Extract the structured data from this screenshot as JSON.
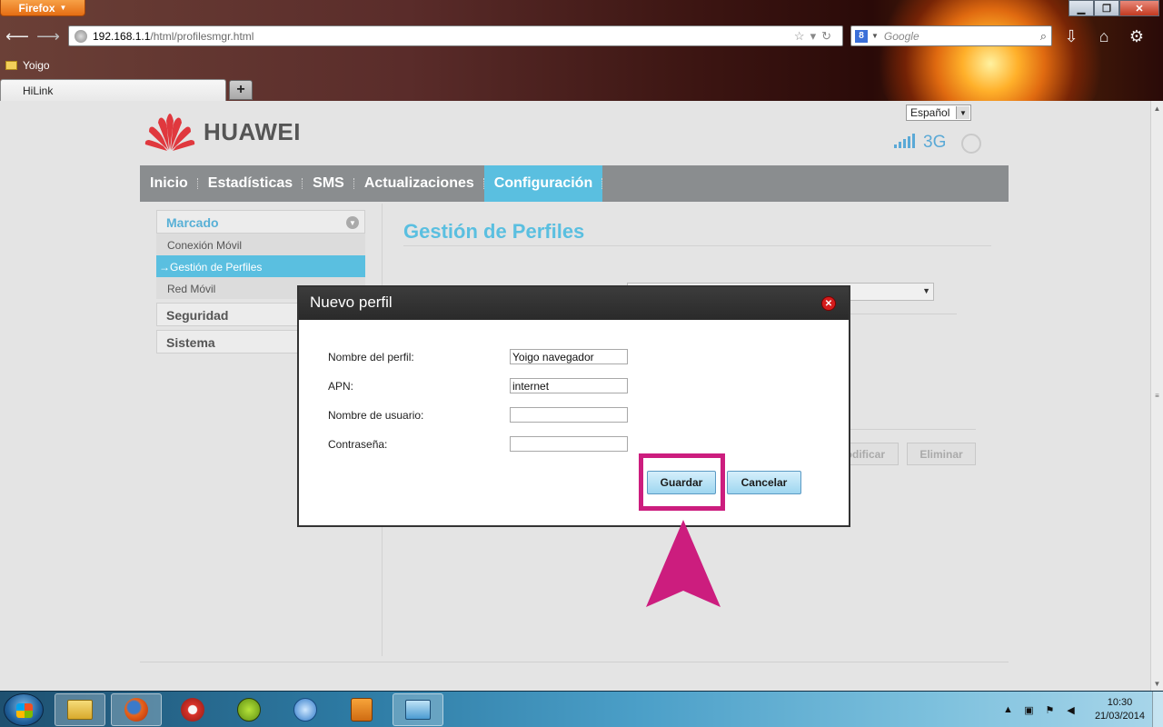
{
  "browser": {
    "menu_button": "Firefox",
    "url_host": "192.168.1.1",
    "url_path": "/html/profilesmgr.html",
    "search_engine_glyph": "8",
    "search_placeholder": "Google",
    "bookmark": "Yoigo",
    "tab_title": "HiLink",
    "new_tab_glyph": "+"
  },
  "router": {
    "brand": "HUAWEI",
    "language": "Español",
    "network_type": "3G",
    "signal_bars": 5,
    "accent_color": "#5abfe0",
    "nav": [
      "Inicio",
      "Estadísticas",
      "SMS",
      "Actualizaciones",
      "Configuración"
    ],
    "nav_active_index": 4,
    "sidebar": {
      "sections": [
        {
          "label": "Marcado",
          "expanded": true,
          "items": [
            "Conexión Móvil",
            "Gestión de Perfiles",
            "Red Móvil"
          ],
          "active_item": "Gestión de Perfiles"
        },
        {
          "label": "Seguridad",
          "expanded": false
        },
        {
          "label": "Sistema",
          "expanded": false
        }
      ],
      "active_marker": "→"
    },
    "page_title": "Gestión de Perfiles",
    "background_buttons": {
      "modify_partial": "odificar",
      "delete": "Eliminar"
    }
  },
  "dialog": {
    "title": "Nuevo perfil",
    "fields": [
      {
        "label": "Nombre del perfil:",
        "value": "Yoigo navegador"
      },
      {
        "label": "APN:",
        "value": "internet"
      },
      {
        "label": "Nombre de usuario:",
        "value": ""
      },
      {
        "label": "Contraseña:",
        "value": ""
      }
    ],
    "save_label": "Guardar",
    "cancel_label": "Cancelar",
    "highlight_color": "#cc1d7e"
  },
  "taskbar": {
    "time": "10:30",
    "date": "21/03/2014"
  }
}
